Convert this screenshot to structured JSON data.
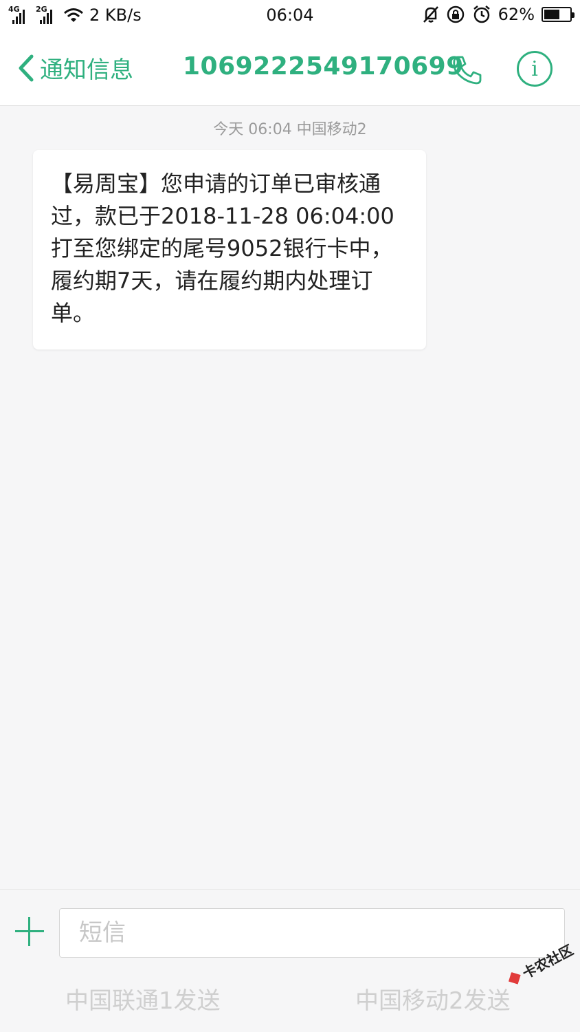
{
  "status_bar": {
    "signal1_tag": "4G",
    "signal2_tag": "2G",
    "speed": "2 KB/s",
    "time": "06:04",
    "battery_percent": "62%",
    "battery_level": 0.62
  },
  "header": {
    "back_label": "通知信息",
    "phone_number": "1069222549170699",
    "accent_color": "#2fb07f"
  },
  "conversation": {
    "timestamp": "今天 06:04  中国移动2",
    "message_text": "【易周宝】您申请的订单已审核通过，款已于2018-11-28 06:04:00打至您绑定的尾号9052银行卡中，履约期7天，请在履约期内处理订单。"
  },
  "composer": {
    "input_placeholder": "短信",
    "send_sim1_label": "中国联通1发送",
    "send_sim2_label": "中国移动2发送"
  },
  "watermark": {
    "text": "卡农社区"
  }
}
